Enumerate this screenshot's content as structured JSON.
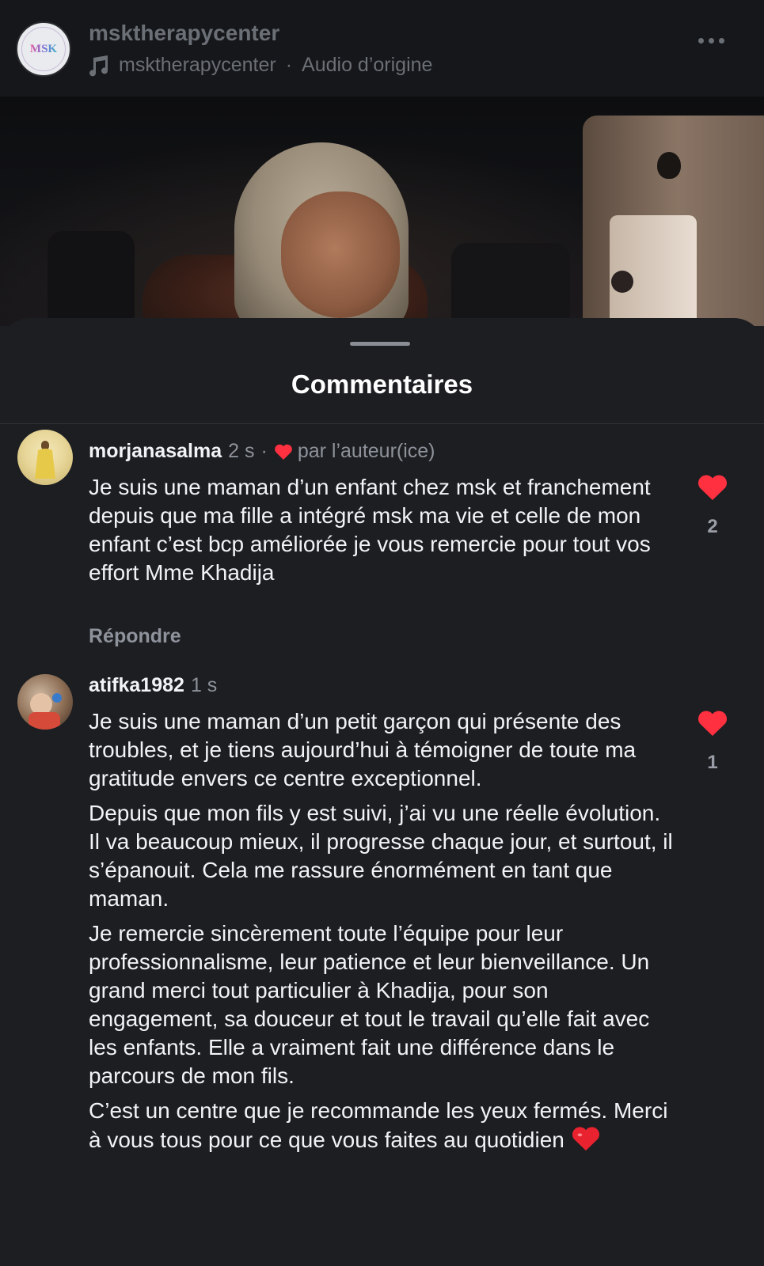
{
  "post": {
    "account": "msktherapycenter",
    "audio_account": "msktherapycenter",
    "audio_sep": "·",
    "audio_label": "Audio d’origine",
    "logo_text": "MSK"
  },
  "sheet": {
    "title": "Commentaires"
  },
  "comments": [
    {
      "username": "morjanasalma",
      "time": "2 s",
      "sep": "·",
      "liked_by_author": "par l’auteur(ice)",
      "paragraphs": [
        "Je suis une maman d’un enfant chez msk et franchement depuis que ma fille a intégré msk ma vie et celle de mon enfant c’est bcp améliorée je vous remercie pour tout vos effort Mme Khadija"
      ],
      "reply": "Répondre",
      "likes": "2"
    },
    {
      "username": "atifka1982",
      "time": "1 s",
      "paragraphs": [
        "Je suis une maman d’un petit garçon qui présente des troubles, et je tiens aujourd’hui à témoigner de toute ma gratitude envers ce centre exceptionnel.",
        "Depuis que mon fils y est suivi, j’ai vu une réelle évolution. Il va beaucoup mieux, il progresse chaque jour, et surtout, il s’épanouit. Cela me rassure énormément en tant que maman.",
        "Je remercie sincèrement toute l’équipe pour leur professionnalisme, leur patience et leur bienveillance. Un grand merci tout particulier à Khadija, pour son engagement, sa douceur et tout le travail qu’elle fait avec les enfants. Elle a vraiment fait une différence dans le parcours de mon fils.",
        "C’est un centre que je recommande les yeux fermés. Merci à vous tous pour ce que vous faites au quotidien"
      ],
      "likes": "1"
    }
  ],
  "colors": {
    "like_red": "#ff3040",
    "muted_text": "#8e929a",
    "sheet_bg": "#1c1e22"
  },
  "icons": {
    "music": "music-note-icon",
    "more": "more-horizontal-icon",
    "like": "heart-icon",
    "emoji": "red-heart-emoji"
  }
}
